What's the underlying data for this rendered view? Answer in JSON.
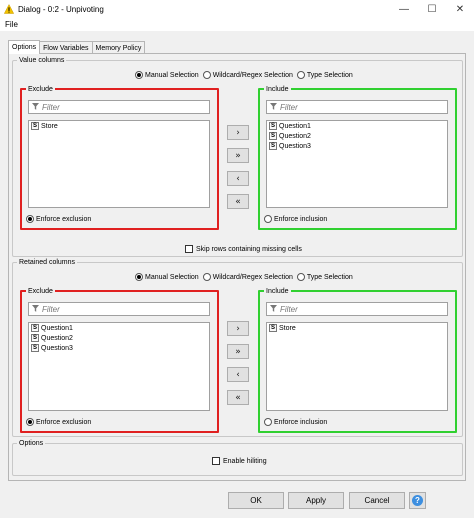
{
  "window": {
    "title": "Dialog - 0:2 - Unpivoting",
    "minimize": "—",
    "maximize": "☐",
    "close": "✕"
  },
  "menu": {
    "file": "File"
  },
  "tabs": [
    {
      "label": "Options",
      "active": true
    },
    {
      "label": "Flow Variables",
      "active": false
    },
    {
      "label": "Memory Policy",
      "active": false
    }
  ],
  "value_columns": {
    "title": "Value columns",
    "mode": {
      "manual": "Manual Selection",
      "wildcard": "Wildcard/Regex Selection",
      "type": "Type Selection",
      "selected": "manual"
    },
    "exclude": {
      "title": "Exclude",
      "filter_placeholder": "Filter",
      "items": [
        {
          "type": "S",
          "name": "Store"
        }
      ],
      "enforce_label": "Enforce exclusion",
      "enforce_selected": true
    },
    "include": {
      "title": "Include",
      "filter_placeholder": "Filter",
      "items": [
        {
          "type": "S",
          "name": "Question1"
        },
        {
          "type": "S",
          "name": "Question2"
        },
        {
          "type": "S",
          "name": "Question3"
        }
      ],
      "enforce_label": "Enforce inclusion",
      "enforce_selected": false
    },
    "buttons": {
      "add": "›",
      "add_all": "»",
      "remove": "‹",
      "remove_all": "«"
    },
    "skip_missing_label": "Skip rows containing missing cells",
    "skip_missing_checked": false
  },
  "retained_columns": {
    "title": "Retained columns",
    "mode": {
      "manual": "Manual Selection",
      "wildcard": "Wildcard/Regex Selection",
      "type": "Type Selection",
      "selected": "manual"
    },
    "exclude": {
      "title": "Exclude",
      "filter_placeholder": "Filter",
      "items": [
        {
          "type": "S",
          "name": "Question1"
        },
        {
          "type": "S",
          "name": "Question2"
        },
        {
          "type": "S",
          "name": "Question3"
        }
      ],
      "enforce_label": "Enforce exclusion",
      "enforce_selected": true
    },
    "include": {
      "title": "Include",
      "filter_placeholder": "Filter",
      "items": [
        {
          "type": "S",
          "name": "Store"
        }
      ],
      "enforce_label": "Enforce inclusion",
      "enforce_selected": false
    },
    "buttons": {
      "add": "›",
      "add_all": "»",
      "remove": "‹",
      "remove_all": "«"
    }
  },
  "options": {
    "title": "Options",
    "hiliting_label": "Enable hiliting",
    "hiliting_checked": false
  },
  "footer": {
    "ok": "OK",
    "apply": "Apply",
    "cancel": "Cancel",
    "help": "?"
  }
}
